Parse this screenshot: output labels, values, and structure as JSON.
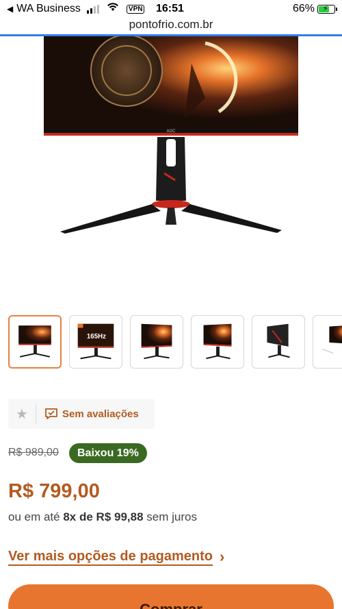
{
  "status_bar": {
    "back_app": "WA Business",
    "vpn": "VPN",
    "time": "16:51",
    "battery_percent": "66%",
    "battery_level": 0.66
  },
  "browser": {
    "url": "pontofrio.com.br",
    "load_progress": 1.0
  },
  "product": {
    "image_icon": "monitor-product-image",
    "thumbnails": [
      {
        "icon": "monitor-front-thumbnail",
        "active": true
      },
      {
        "icon": "monitor-165hz-box-thumbnail",
        "active": false
      },
      {
        "icon": "monitor-angle-left-thumbnail",
        "active": false
      },
      {
        "icon": "monitor-angle-right-thumbnail",
        "active": false
      },
      {
        "icon": "monitor-side-thumbnail",
        "active": false
      },
      {
        "icon": "monitor-back-thumbnail",
        "active": false
      }
    ],
    "thumb_box_text": "165Hz"
  },
  "rating": {
    "star_icon": "star-icon",
    "review_label": "Sem avaliações"
  },
  "pricing": {
    "old_price": "R$ 989,00",
    "discount_badge": "Baixou 19%",
    "price": "R$ 799,00",
    "installments_prefix": "ou em até",
    "installments_bold": "8x de R$ 99,88",
    "installments_suffix": "sem juros",
    "more_payment_label": "Ver mais opções de pagamento"
  },
  "actions": {
    "buy_label": "Comprar"
  },
  "colors": {
    "accent": "#b35a1f",
    "buy_button": "#e8752f",
    "badge_green": "#3a6a22",
    "active_thumb_border": "#e8803f"
  }
}
